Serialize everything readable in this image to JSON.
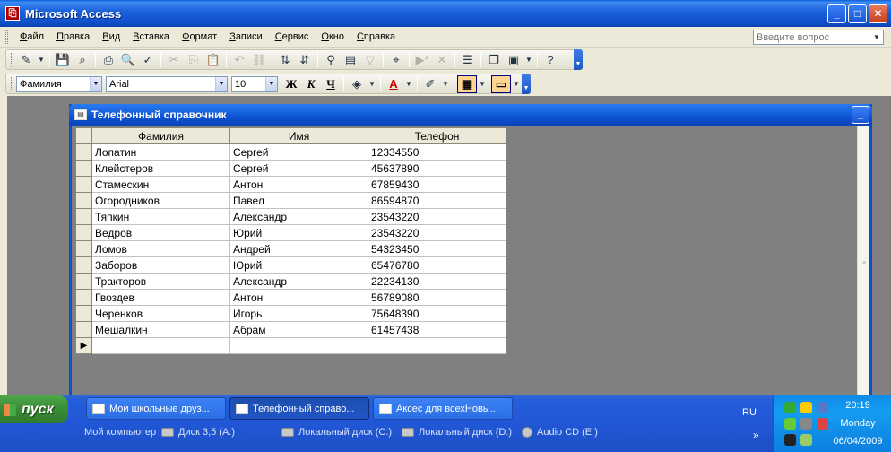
{
  "window": {
    "title": "Microsoft Access",
    "min_icon": "minimize-icon",
    "max_icon": "maximize-icon",
    "close_icon": "close-icon"
  },
  "menu": {
    "items": [
      "Файл",
      "Правка",
      "Вид",
      "Вставка",
      "Формат",
      "Записи",
      "Сервис",
      "Окно",
      "Справка"
    ],
    "help_placeholder": "Введите вопрос"
  },
  "format_toolbar": {
    "field": "Фамилия",
    "font": "Arial",
    "size": "10",
    "bold": "Ж",
    "italic": "К",
    "underline": "Ч"
  },
  "table_window": {
    "title": "Телефонный справочник",
    "columns": [
      "Фамилия",
      "Имя",
      "Телефон"
    ],
    "rows": [
      [
        "Лопатин",
        "Сергей",
        "12334550"
      ],
      [
        "Клейстеров",
        "Сергей",
        "45637890"
      ],
      [
        "Стамескин",
        "Антон",
        "67859430"
      ],
      [
        "Огородников",
        "Павел",
        "86594870"
      ],
      [
        "Тяпкин",
        "Александр",
        "23543220"
      ],
      [
        "Ведров",
        "Юрий",
        "23543220"
      ],
      [
        "Ломов",
        "Андрей",
        "54323450"
      ],
      [
        "Заборов",
        "Юрий",
        "65476780"
      ],
      [
        "Тракторов",
        "Александр",
        "22234130"
      ],
      [
        "Гвоздев",
        "Антон",
        "56789080"
      ],
      [
        "Черенков",
        "Игорь",
        "75648390"
      ],
      [
        "Мешалкин",
        "Абрам",
        "61457438"
      ]
    ]
  },
  "taskbar": {
    "start_label": "пуск",
    "tasks": [
      "Мои школьные друз...",
      "Телефонный справо...",
      "Аксес для всехНовы..."
    ],
    "quick_links": [
      "Мой компьютер",
      "Диск 3,5 (A:)",
      "Локальный диск (C:)",
      "Локальный диск (D:)",
      "Audio CD (E:)"
    ],
    "lang": "RU",
    "chevron": "»",
    "time": "20:19",
    "day": "Monday",
    "date": "06/04/2009"
  },
  "colors": {
    "title_blue": "#0f4fc8",
    "workspace_gray": "#808080",
    "toolbar_beige": "#ece9d8",
    "start_green": "#3c8f38",
    "tray_blue": "#149df0"
  }
}
